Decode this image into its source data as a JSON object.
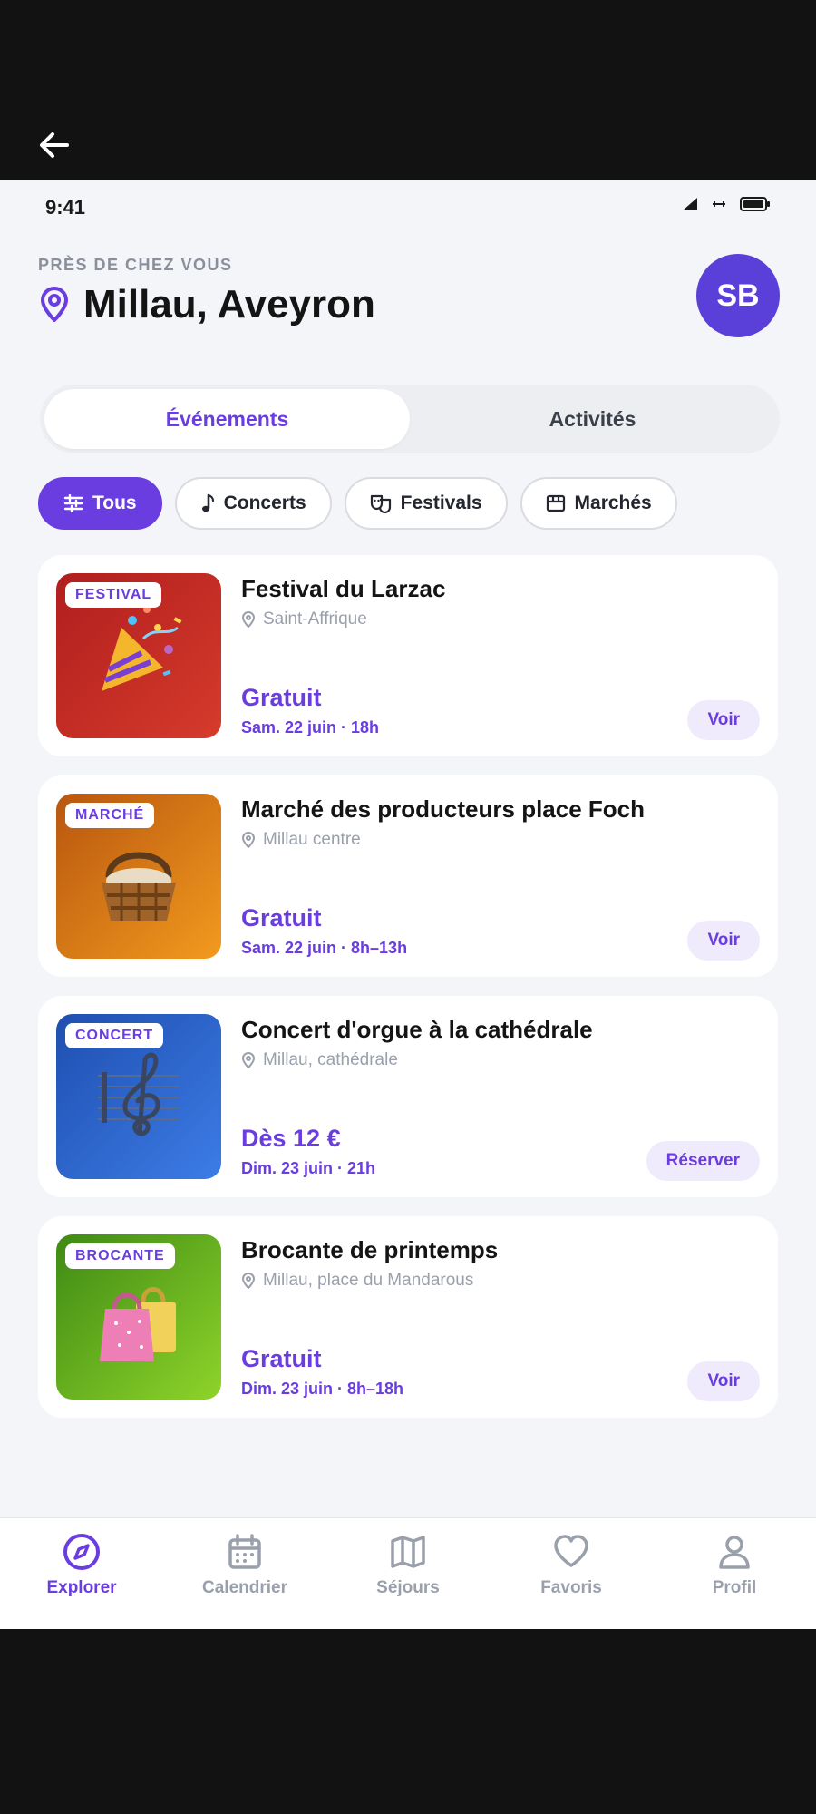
{
  "status": {
    "time": "9:41"
  },
  "header": {
    "kicker": "PRÈS DE CHEZ VOUS",
    "location": "Millau, Aveyron",
    "avatar_initials": "SB"
  },
  "tabs": [
    {
      "label": "Événements",
      "active": true
    },
    {
      "label": "Activités",
      "active": false
    }
  ],
  "chips": [
    {
      "label": "Tous",
      "icon": "sliders-icon",
      "active": true
    },
    {
      "label": "Concerts",
      "icon": "music-note-icon",
      "active": false
    },
    {
      "label": "Festivals",
      "icon": "masks-icon",
      "active": false
    },
    {
      "label": "Marchés",
      "icon": "store-icon",
      "active": false
    }
  ],
  "events": [
    {
      "badge": "FESTIVAL",
      "title": "Festival du Larzac",
      "place": "Saint-Affrique",
      "price": "Gratuit",
      "date": "Sam. 22 juin · 18h",
      "action": "Voir",
      "icon": "party-popper-icon",
      "color_from": "#b01e1e",
      "color_to": "#d63b2b"
    },
    {
      "badge": "MARCHÉ",
      "title": "Marché des producteurs place Foch",
      "place": "Millau centre",
      "price": "Gratuit",
      "date": "Sam. 22 juin · 8h–13h",
      "action": "Voir",
      "icon": "basket-icon",
      "color_from": "#b8560f",
      "color_to": "#f29a1e"
    },
    {
      "badge": "CONCERT",
      "title": "Concert d'orgue à la cathédrale",
      "place": "Millau, cathédrale",
      "price": "Dès 12 €",
      "date": "Dim. 23 juin · 21h",
      "action": "Réserver",
      "icon": "treble-clef-icon",
      "color_from": "#1f4fb0",
      "color_to": "#3c7ce6"
    },
    {
      "badge": "BROCANTE",
      "title": "Brocante de printemps",
      "place": "Millau, place du Mandarous",
      "price": "Gratuit",
      "date": "Dim. 23 juin · 8h–18h",
      "action": "Voir",
      "icon": "shopping-bags-icon",
      "color_from": "#3e8a14",
      "color_to": "#8fd42a"
    }
  ],
  "nav": [
    {
      "label": "Explorer",
      "icon": "compass-icon",
      "active": true
    },
    {
      "label": "Calendrier",
      "icon": "calendar-icon",
      "active": false
    },
    {
      "label": "Séjours",
      "icon": "map-icon",
      "active": false
    },
    {
      "label": "Favoris",
      "icon": "heart-icon",
      "active": false
    },
    {
      "label": "Profil",
      "icon": "user-icon",
      "active": false
    }
  ],
  "colors": {
    "accent": "#6a3de0",
    "avatar": "#5b3fd9",
    "background": "#f4f5f8"
  }
}
